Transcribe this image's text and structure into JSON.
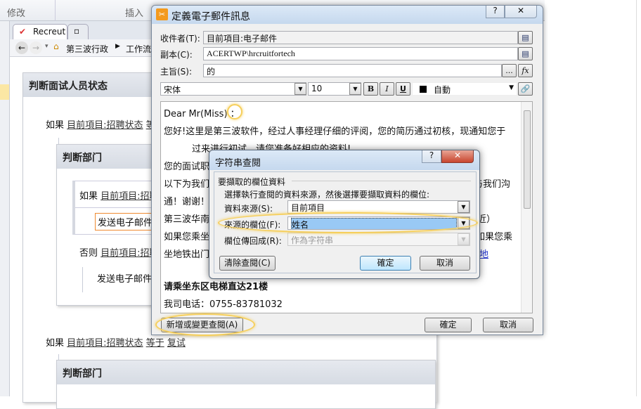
{
  "ribbon": {
    "tabs": [
      "修改",
      "插入"
    ]
  },
  "browser": {
    "tabs": [
      {
        "label": "Recreut"
      }
    ],
    "breadcrumb": [
      "第三波行政",
      "工作流"
    ]
  },
  "workflow": {
    "title": "判断面试人员状态",
    "condition1": {
      "prefix": "如果",
      "link": "目前項目:招聘状态",
      "rest": "等"
    },
    "inner": {
      "title": "判断部门",
      "if_prefix": "如果",
      "if_link": "目前項目:招聘",
      "action1": "发送电子邮件",
      "else_prefix": "否则",
      "else_link": "目前項目:招聘",
      "action2": "发送电子邮件"
    },
    "condition2": {
      "prefix": "如果",
      "link": "目前項目:招聘状态",
      "rest1": "等于",
      "rest2": "复试"
    },
    "inner2": {
      "title": "判断部门"
    }
  },
  "email_dialog": {
    "title": "定義電子郵件訊息",
    "help": "?",
    "close": "✕",
    "to_label": "收件者(T):",
    "to_value": "目前項目:电子邮件",
    "cc_label": "副本(C):",
    "cc_value": "ACERTWP\\hrcruitfortech",
    "subject_label": "主旨(S):",
    "subject_value": "的",
    "font": "宋体",
    "size": "10",
    "bold": "B",
    "italic": "I",
    "underline": "U",
    "color": "自動",
    "ellipsis": "...",
    "fx": "fx",
    "body": [
      "Dear Mr(Miss) ：",
      "您好!这里是第三波软件，经过人事经理仔细的评阅，您的简历通过初核，现通知您于",
      "过来进行初试，请您准备好相应的资料!",
      "您的面试职",
      "以下为我们",
      "通！谢谢！",
      "第三波华南",
      "如果您乘坐",
      "坐地铁出门",
      "请乘坐东区电梯直达21楼",
      "我司电话：0755-83781032"
    ],
    "body_right": [
      "与我们沟",
      "近）",
      "如果您乘",
      "地"
    ],
    "add_lookup": "新增或變更查閱(A)",
    "ok": "確定",
    "cancel": "取消"
  },
  "lookup_dialog": {
    "title": "字符串查閱",
    "help": "?",
    "close": "✕",
    "group": "要擷取的欄位資料",
    "instruction": "選擇執行查閱的資料來源，然後選擇要擷取資料的欄位:",
    "source_label": "資料來源(S):",
    "source_value": "目前項目",
    "field_label": "來源的欄位(F):",
    "field_value": "姓名",
    "return_label": "欄位傳回成(R):",
    "return_value": "作為字符串",
    "clear": "清除查閱(C)",
    "ok": "確定",
    "cancel": "取消"
  }
}
